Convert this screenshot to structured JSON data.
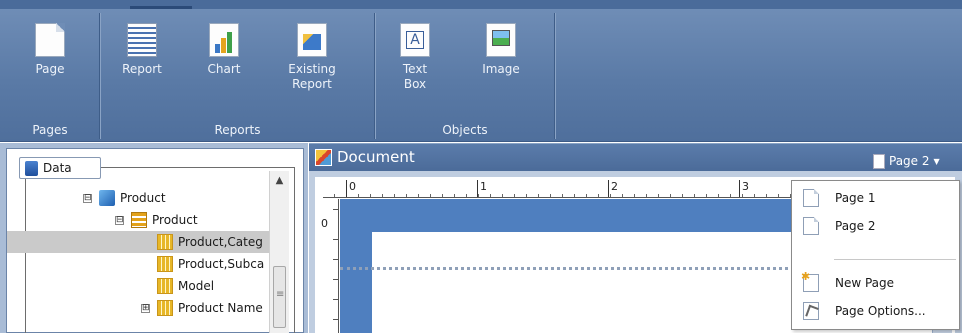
{
  "ribbon": {
    "groups": [
      {
        "title": "Pages",
        "buttons": [
          {
            "label": "Page",
            "icon": "page-icon"
          }
        ]
      },
      {
        "title": "Reports",
        "buttons": [
          {
            "label": "Report",
            "icon": "report-icon"
          },
          {
            "label": "Chart",
            "icon": "chart-icon"
          },
          {
            "label": "Existing Report",
            "icon": "existing-report-icon"
          }
        ]
      },
      {
        "title": "Objects",
        "buttons": [
          {
            "label": "Text Box",
            "icon": "text-box-icon"
          },
          {
            "label": "Image",
            "icon": "image-icon"
          }
        ]
      }
    ]
  },
  "data_panel": {
    "tab_label": "Data",
    "tree": [
      {
        "label": "Product",
        "expander": "⊟",
        "icon": "cube-icon"
      },
      {
        "label": "Product",
        "expander": "⊟",
        "icon": "hierarchy-icon"
      },
      {
        "label": "Product,Categ",
        "icon": "dimension-grid-icon",
        "selected": true
      },
      {
        "label": "Product,Subca",
        "icon": "dimension-grid-icon"
      },
      {
        "label": "Model",
        "icon": "dimension-grid-icon"
      },
      {
        "label": "Product Name",
        "expander": "⊞",
        "icon": "dimension-grid-icon"
      }
    ]
  },
  "document": {
    "title": "Document",
    "page_selector": "Page 2",
    "ruler_h_labels": [
      "0",
      "1",
      "2",
      "3"
    ],
    "ruler_v_label": "0"
  },
  "page_menu": {
    "items": [
      {
        "label": "Page 1",
        "icon": "page-icon"
      },
      {
        "label": "Page 2",
        "icon": "page-icon"
      },
      {
        "label": "New Page",
        "icon": "new-page-icon"
      },
      {
        "label": "Page Options...",
        "icon": "page-options-icon"
      }
    ]
  },
  "colors": {
    "ribbon": "#5a7aa6",
    "accent_blue": "#4f7fbf",
    "selection_gray": "#cacaca"
  }
}
